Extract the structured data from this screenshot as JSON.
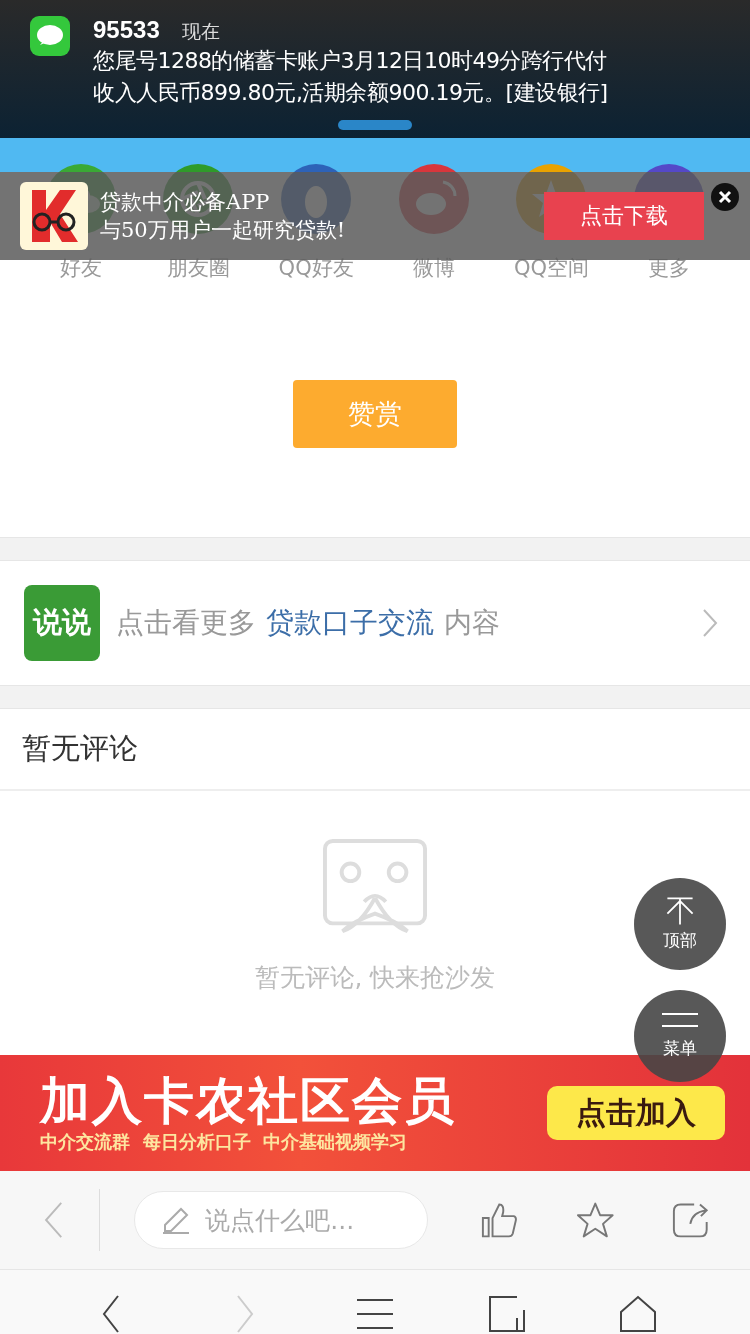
{
  "notification": {
    "sender": "95533",
    "time": "现在",
    "message_lines": [
      "您尾号1288的储蓄卡账户3月12日10时49分跨行代付",
      "收入人民币899.80元,活期余额900.19元。[建设银行]"
    ]
  },
  "share": [
    {
      "label": "好友",
      "kind": "chat"
    },
    {
      "label": "朋友圈",
      "kind": "shutter"
    },
    {
      "label": "QQ好友",
      "kind": "penguin"
    },
    {
      "label": "微博",
      "kind": "weibo"
    },
    {
      "label": "QQ空间",
      "kind": "star"
    },
    {
      "label": "更多",
      "kind": "more"
    }
  ],
  "app_ad": {
    "line_1": "贷款中介必备APP",
    "line_2": "与50万用户一起研究贷款!",
    "button": "点击下载"
  },
  "reward_button": "赞赏",
  "topic": {
    "badge": "说说",
    "prefix": "点击看更多",
    "link": "贷款口子交流",
    "suffix": "内容"
  },
  "comments": {
    "title": "暂无评论",
    "empty_text": "暂无评论, 快来抢沙发"
  },
  "float_buttons": [
    {
      "label": "顶部",
      "kind": "top"
    },
    {
      "label": "菜单",
      "kind": "menu"
    }
  ],
  "banner": {
    "title": "加入卡农社区会员",
    "subtitle": "中介交流群  每日分析口子  中介基础视频学习",
    "button": "点击加入"
  },
  "toolbar": {
    "placeholder": "说点什么吧..."
  },
  "nav": [
    {
      "kind": "back",
      "disabled": false
    },
    {
      "kind": "forward",
      "disabled": true
    },
    {
      "kind": "menu",
      "disabled": false
    },
    {
      "kind": "tabs",
      "disabled": false
    },
    {
      "kind": "home",
      "disabled": false
    }
  ]
}
